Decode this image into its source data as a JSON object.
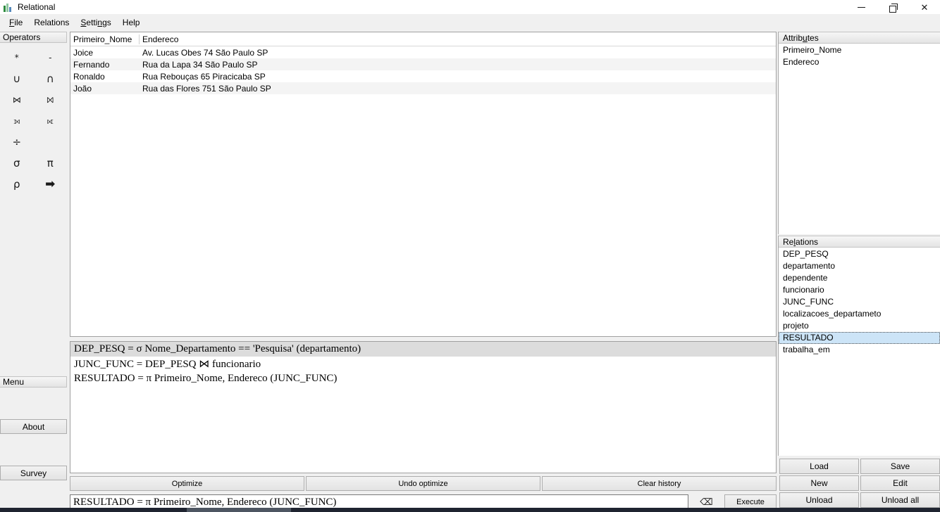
{
  "window": {
    "title": "Relational",
    "icon": "app-bars-icon",
    "controls": {
      "minimize": "minimize-icon",
      "maximize": "restore-icon",
      "close": "close-icon",
      "close_glyph": "✕"
    }
  },
  "menubar": {
    "items": [
      {
        "label": "File",
        "mnemonic": "F"
      },
      {
        "label": "Relations",
        "mnemonic": ""
      },
      {
        "label": "Settings",
        "mnemonic": "S"
      },
      {
        "label": "Help",
        "mnemonic": ""
      }
    ]
  },
  "sidebar": {
    "header": "Operators",
    "operators": [
      {
        "glyph": "*",
        "name": "cartesian-product"
      },
      {
        "glyph": "-",
        "name": "difference"
      },
      {
        "glyph": "∪",
        "name": "union"
      },
      {
        "glyph": "∩",
        "name": "intersection"
      },
      {
        "glyph": "⋈",
        "name": "natural-join"
      },
      {
        "glyph": "⨝",
        "name": "theta-join"
      },
      {
        "glyph": "⟕",
        "name": "left-outer-join"
      },
      {
        "glyph": "⟖",
        "name": "right-outer-join"
      },
      {
        "glyph": "÷",
        "name": "division"
      },
      {
        "glyph": "",
        "name": "spacer"
      },
      {
        "glyph": "σ",
        "name": "selection"
      },
      {
        "glyph": "π",
        "name": "projection"
      },
      {
        "glyph": "ρ",
        "name": "rename"
      },
      {
        "glyph": "➡",
        "name": "assignment-arrow"
      }
    ],
    "menu_header": "Menu",
    "about_label": "About",
    "survey_label": "Survey"
  },
  "results": {
    "columns": [
      "Primeiro_Nome",
      "Endereco"
    ],
    "rows": [
      [
        "Joice",
        "Av. Lucas Obes 74 São Paulo SP"
      ],
      [
        "Fernando",
        "Rua da Lapa 34 São Paulo SP"
      ],
      [
        "Ronaldo",
        "Rua Rebouças 65 Piracicaba SP"
      ],
      [
        "João",
        "Rua das Flores 751 São Paulo SP"
      ]
    ]
  },
  "history": {
    "entries": [
      "DEP_PESQ = σ Nome_Departamento == 'Pesquisa' (departamento)",
      "JUNC_FUNC = DEP_PESQ ⋈ funcionario",
      "RESULTADO = π Primeiro_Nome, Endereco (JUNC_FUNC)"
    ],
    "actions": [
      "Optimize",
      "Undo optimize",
      "Clear history"
    ]
  },
  "query": {
    "value": "RESULTADO = π Primeiro_Nome, Endereco (JUNC_FUNC)",
    "placeholder": "",
    "erase_icon": "backspace-icon",
    "erase_glyph": "⌫",
    "execute_label": "Execute"
  },
  "attributes": {
    "header": "Attributes",
    "header_mnemonic": "u",
    "items": [
      "Primeiro_Nome",
      "Endereco"
    ]
  },
  "relations": {
    "header": "Relations",
    "header_mnemonic": "l",
    "items": [
      "DEP_PESQ",
      "departamento",
      "dependente",
      "funcionario",
      "JUNC_FUNC",
      "localizacoes_departameto",
      "projeto",
      "RESULTADO",
      "trabalha_em"
    ],
    "selected": "RESULTADO",
    "actions": [
      "Load",
      "Save",
      "New",
      "Edit",
      "Unload",
      "Unload all"
    ]
  },
  "colors": {
    "selection": "#cce4f7",
    "chrome": "#f0f0f0",
    "history_alt_row": "#dcdcdc",
    "table_alt_row": "#f4f4f4"
  }
}
